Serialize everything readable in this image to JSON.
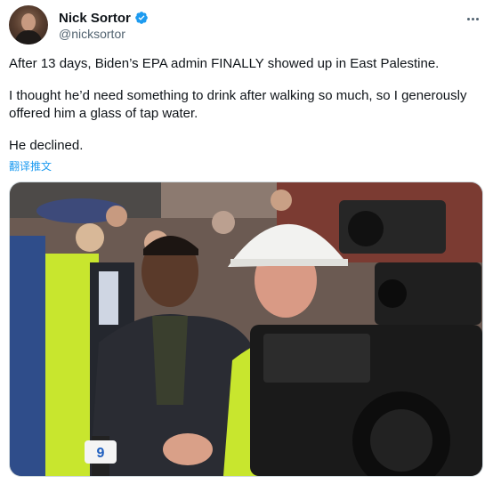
{
  "author": {
    "display_name": "Nick Sortor",
    "handle": "@nicksortor",
    "verified": true,
    "verified_icon": "verified-badge-icon",
    "avatar_icon": "avatar"
  },
  "menu_icon": "more-options-icon",
  "tweet": {
    "paragraphs": [
      "After 13 days, Biden’s EPA admin FINALLY showed up in East Palestine.",
      "I thought he’d need something to drink after walking so much, so I generously offered him a glass of tap water.",
      "He declined."
    ],
    "translate_label": "翻译推文"
  },
  "media": {
    "mic_flag_text": "9",
    "colors": {
      "safety_vest": "#c8e62e",
      "hard_hat": "#f2f2f0",
      "brick": "#7b3b32",
      "accent_link": "#1d9bf0"
    }
  }
}
